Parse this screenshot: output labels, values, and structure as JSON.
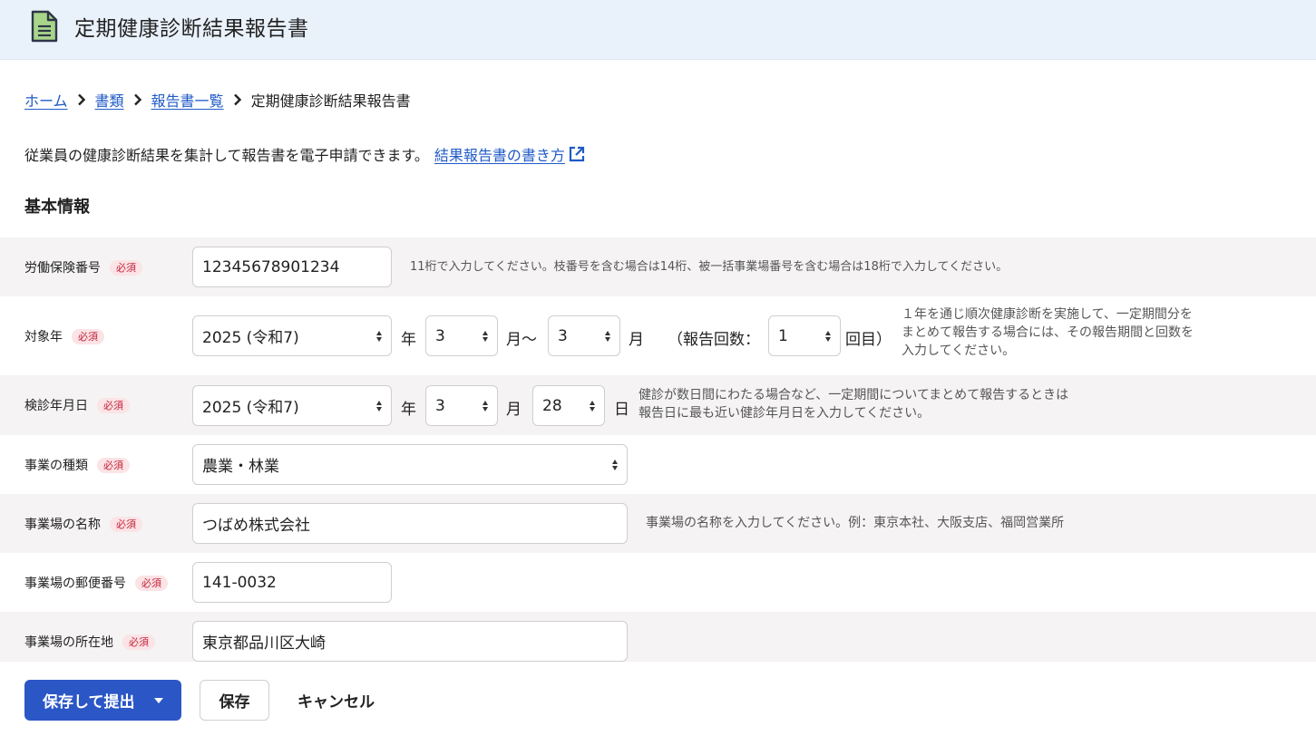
{
  "header": {
    "title": "定期健康診断結果報告書",
    "icon": "document-icon"
  },
  "breadcrumb": {
    "home": "ホーム",
    "docs": "書類",
    "list": "報告書一覧",
    "current": "定期健康診断結果報告書"
  },
  "intro": {
    "text": "従業員の健康診断結果を集計して報告書を電子申請できます。",
    "link": "結果報告書の書き方"
  },
  "section_title": "基本情報",
  "required_badge": "必須",
  "form": {
    "insurance_no": {
      "label": "労働保険番号",
      "value": "12345678901234",
      "hint": "11桁で入力してください。枝番号を含む場合は14桁、被一括事業場番号を含む場合は18桁で入力してください。"
    },
    "target_year": {
      "label": "対象年",
      "year": "2025 (令和7)",
      "year_unit": "年",
      "month_from": "3",
      "month_from_unit": "月〜",
      "month_to": "3",
      "month_to_unit": "月",
      "count_prefix": "（報告回数：",
      "count": "1",
      "count_suffix": "回目）",
      "hint_1": "１年を通じ順次健康診断を実施して、一定期間分を",
      "hint_2": "まとめて報告する場合には、その報告期間と回数を",
      "hint_3": "入力してください。"
    },
    "exam_date": {
      "label": "検診年月日",
      "year": "2025 (令和7)",
      "year_unit": "年",
      "month": "3",
      "month_unit": "月",
      "day": "28",
      "day_unit": "日",
      "hint_1": "健診が数日間にわたる場合など、一定期間についてまとめて報告するときは",
      "hint_2": "報告日に最も近い健診年月日を入力してください。"
    },
    "business_type": {
      "label": "事業の種類",
      "value": "農業・林業"
    },
    "site_name": {
      "label": "事業場の名称",
      "value": "つばめ株式会社",
      "hint": "事業場の名称を入力してください。例：東京本社、大阪支店、福岡営業所"
    },
    "postal_code": {
      "label": "事業場の郵便番号",
      "value": "141-0032"
    },
    "address": {
      "label": "事業場の所在地",
      "value": "東京都品川区大崎"
    }
  },
  "actions": {
    "submit": "保存して提出",
    "save": "保存",
    "cancel": "キャンセル"
  },
  "colors": {
    "primary": "#2a56c6",
    "link": "#1f5ac7",
    "badge_text": "#c3233a",
    "badge_bg": "#fbe3e6",
    "header_bg": "#e9f1fb"
  }
}
